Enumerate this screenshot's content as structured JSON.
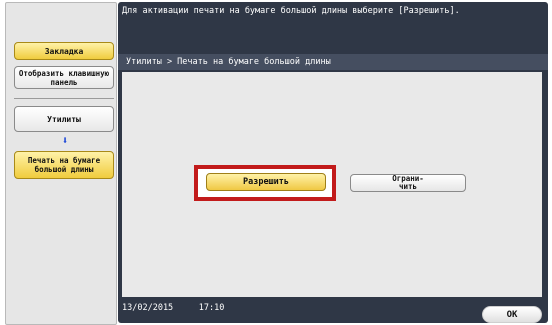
{
  "message": "Для активации печати на бумаге большой длины выберите [Разрешить].",
  "sidebar": {
    "bookmark": "Закладка",
    "keypad": "Отобразить клавишную панель",
    "utilities": "Утилиты",
    "arrow_icon": "down-arrow-icon",
    "current": "Печать на бумаге большой длины"
  },
  "breadcrumb": "Утилиты > Печать на бумаге большой длины",
  "options": {
    "allow": "Разрешить",
    "restrict": "Ограни- чить",
    "selected": "allow"
  },
  "footer": {
    "date": "13/02/2015",
    "time": "17:10"
  },
  "ok_label": "OK",
  "colors": {
    "panel": "#2f3746",
    "accent": "#f0cc3e",
    "highlight": "#c21b1b"
  }
}
